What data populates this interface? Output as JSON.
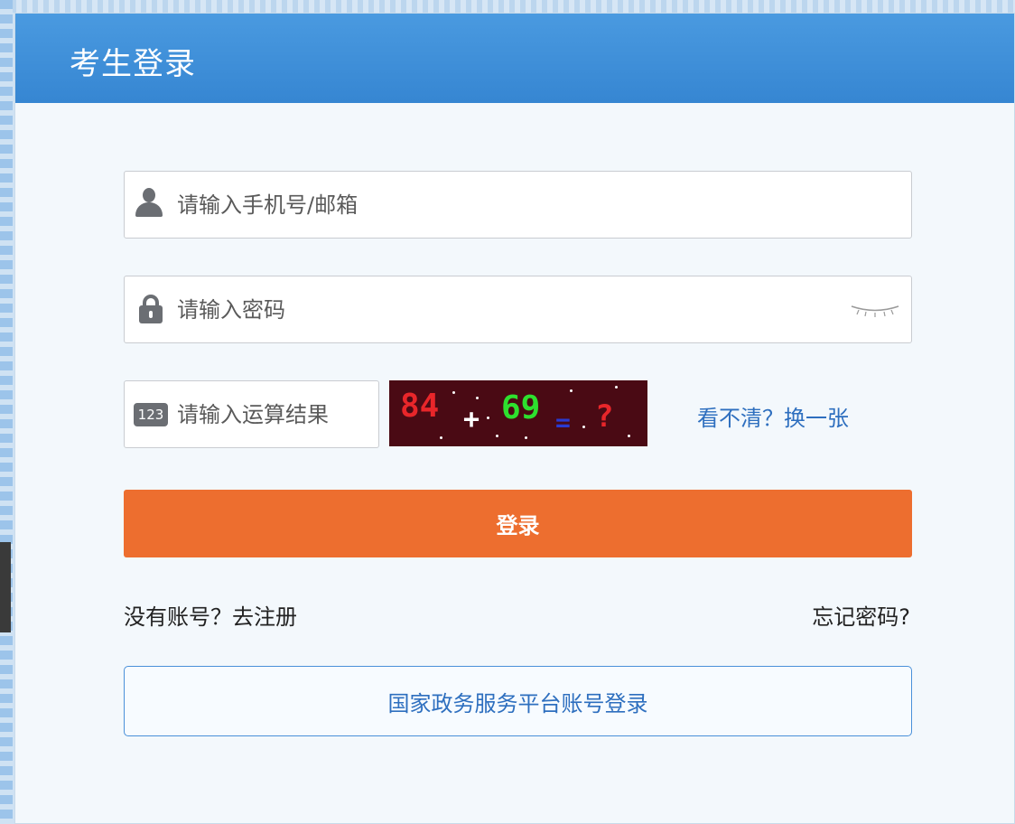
{
  "header": {
    "title": "考生登录"
  },
  "form": {
    "account": {
      "placeholder": "请输入手机号/邮箱",
      "value": ""
    },
    "password": {
      "placeholder": "请输入密码",
      "value": ""
    },
    "captcha": {
      "icon_label": "123",
      "placeholder": "请输入运算结果",
      "value": "",
      "image": {
        "operand1": "84",
        "operator": "+",
        "operand2": "69",
        "equals": "=",
        "question": "?"
      },
      "refresh_label": "看不清？换一张"
    },
    "login_label": "登录",
    "register_label": "没有账号？去注册",
    "forgot_label": "忘记密码?",
    "gov_login_label": "国家政务服务平台账号登录"
  },
  "colors": {
    "header_blue": "#3a8ad6",
    "login_orange": "#ed6e2f",
    "link_blue": "#2e6fbf",
    "captcha_bg": "#4a0a14"
  }
}
